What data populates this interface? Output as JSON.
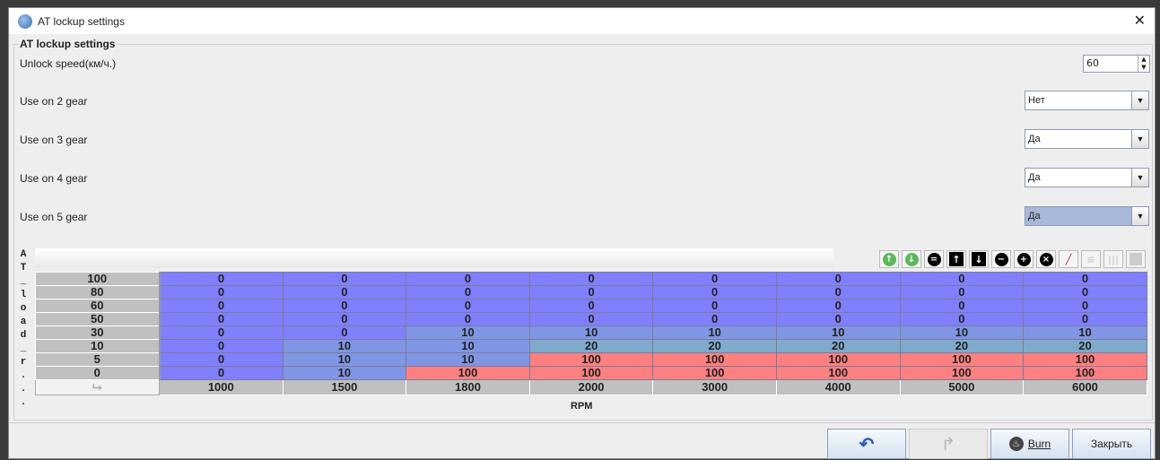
{
  "window": {
    "title": "AT lockup settings"
  },
  "group": {
    "legend": "AT lockup settings"
  },
  "unlock_speed": {
    "label": "Unlock speed(км/ч.)",
    "value": "60"
  },
  "gears": [
    {
      "label": "Use on 2 gear",
      "value": "Нет"
    },
    {
      "label": "Use on 3 gear",
      "value": "Да"
    },
    {
      "label": "Use on 4 gear",
      "value": "Да"
    },
    {
      "label": "Use on 5 gear",
      "value": "Да"
    }
  ],
  "table": {
    "y_axis_label": "AT_load_r...",
    "x_axis_label": "RPM",
    "rows": [
      "100",
      "80",
      "60",
      "50",
      "30",
      "10",
      "5",
      "0"
    ],
    "cols": [
      "1000",
      "1500",
      "1800",
      "2000",
      "3000",
      "4000",
      "5000",
      "6000"
    ],
    "values": [
      [
        0,
        0,
        0,
        0,
        0,
        0,
        0,
        0
      ],
      [
        0,
        0,
        0,
        0,
        0,
        0,
        0,
        0
      ],
      [
        0,
        0,
        0,
        0,
        0,
        0,
        0,
        0
      ],
      [
        0,
        0,
        0,
        0,
        0,
        0,
        0,
        0
      ],
      [
        0,
        0,
        10,
        10,
        10,
        10,
        10,
        10
      ],
      [
        0,
        10,
        10,
        20,
        20,
        20,
        20,
        20
      ],
      [
        0,
        10,
        10,
        100,
        100,
        100,
        100,
        100
      ],
      [
        0,
        10,
        100,
        100,
        100,
        100,
        100,
        100
      ]
    ],
    "colors": {
      "0": "#8080ff",
      "10": "#8096e4",
      "20": "#80aacc",
      "100": "#ff8080"
    }
  },
  "toolbar": [
    "increase-icon",
    "decrease-icon",
    "set-equal-icon",
    "shift-up-icon",
    "shift-down-icon",
    "subtract-icon",
    "add-icon",
    "multiply-icon",
    "pencil-icon",
    "interpolate-rows-icon",
    "interpolate-cols-icon",
    "interpolate-all-icon"
  ],
  "buttons": {
    "undo": "undo-icon",
    "redo": "redo-icon",
    "burn": "Burn",
    "close": "Закрыть"
  }
}
